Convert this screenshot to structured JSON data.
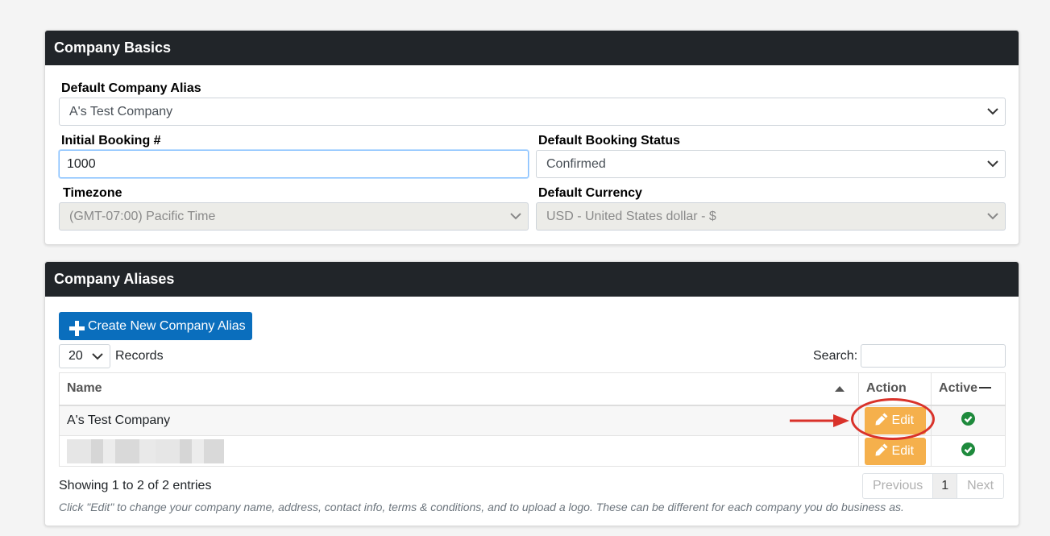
{
  "basics": {
    "title": "Company Basics",
    "alias_label": "Default Company Alias",
    "alias_value": "A's Test Company",
    "booking_label": "Initial Booking #",
    "booking_value": "1000",
    "status_label": "Default Booking Status",
    "status_value": "Confirmed",
    "timezone_label": "Timezone",
    "timezone_value": "(GMT-07:00) Pacific Time",
    "currency_label": "Default Currency",
    "currency_value": "USD - United States dollar - $"
  },
  "aliases": {
    "title": "Company Aliases",
    "create_label": "Create New Company Alias",
    "records_value": "20",
    "records_label": "Records",
    "search_label": "Search:",
    "columns": [
      "Name",
      "Action",
      "Active"
    ],
    "rows": [
      {
        "name": "A's Test Company",
        "action": "Edit",
        "active": true
      },
      {
        "name": "",
        "action": "Edit",
        "active": true
      }
    ],
    "showing": "Showing 1 to 2 of 2 entries",
    "pager": {
      "previous": "Previous",
      "current": "1",
      "next": "Next"
    },
    "note": "Click \"Edit\" to change your company name, address, contact info, terms & conditions, and to upload a logo. These can be different for each company you do business as."
  },
  "colors": {
    "header": "#212529",
    "primary": "#0a6ebd",
    "edit": "#f5b04c",
    "success": "#1e8a3c",
    "annotation": "#d9322a"
  }
}
